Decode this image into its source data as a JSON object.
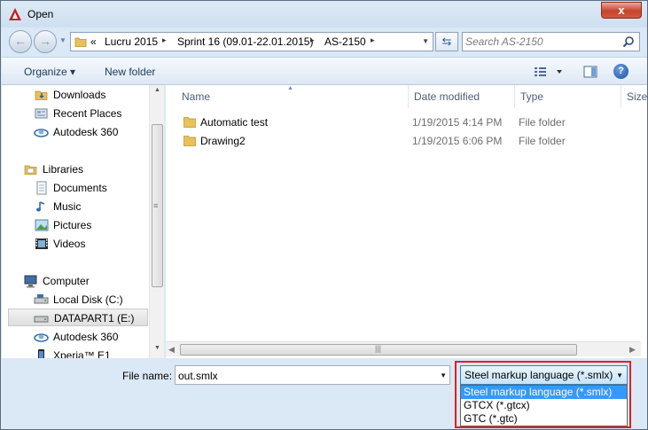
{
  "window": {
    "title": "Open",
    "close_label": "x"
  },
  "address": {
    "overflow": "«",
    "crumbs": [
      "Lucru 2015",
      "Sprint 16 (09.01-22.01.2015)",
      "AS-2150"
    ],
    "separator": "▸"
  },
  "search": {
    "placeholder": "Search AS-2150"
  },
  "toolbar": {
    "organize_label": "Organize ▾",
    "new_folder_label": "New folder",
    "help_label": "?"
  },
  "nav": {
    "items": [
      {
        "label": "Downloads",
        "icon": "downloads-icon"
      },
      {
        "label": "Recent Places",
        "icon": "recent-places-icon"
      },
      {
        "label": "Autodesk 360",
        "icon": "cloud-icon"
      },
      {
        "label": "Libraries",
        "icon": "libraries-icon"
      },
      {
        "label": "Documents",
        "icon": "documents-icon"
      },
      {
        "label": "Music",
        "icon": "music-icon"
      },
      {
        "label": "Pictures",
        "icon": "pictures-icon"
      },
      {
        "label": "Videos",
        "icon": "videos-icon"
      },
      {
        "label": "Computer",
        "icon": "computer-icon"
      },
      {
        "label": "Local Disk (C:)",
        "icon": "disk-icon"
      },
      {
        "label": "DATAPART1 (E:)",
        "icon": "disk-icon",
        "selected": true
      },
      {
        "label": "Autodesk 360",
        "icon": "cloud-icon"
      },
      {
        "label": "Xperia™ E1",
        "icon": "phone-icon"
      }
    ]
  },
  "list": {
    "columns": [
      "Name",
      "Date modified",
      "Type",
      "Size"
    ],
    "rows": [
      {
        "name": "Automatic test",
        "date": "1/19/2015 4:14 PM",
        "type": "File folder"
      },
      {
        "name": "Drawing2",
        "date": "1/19/2015 6:06 PM",
        "type": "File folder"
      }
    ]
  },
  "file_name": {
    "label": "File name:",
    "value": "out.smlx"
  },
  "file_type": {
    "selected": "Steel markup language (*.smlx)",
    "options": [
      "Steel markup language (*.smlx)",
      "GTCX (*.gtcx)",
      "GTC (*.gtc)"
    ]
  },
  "colors": {
    "accent": "#3399ff",
    "highlight_frame": "#e02020",
    "window_bg": "#dbe8f5"
  }
}
